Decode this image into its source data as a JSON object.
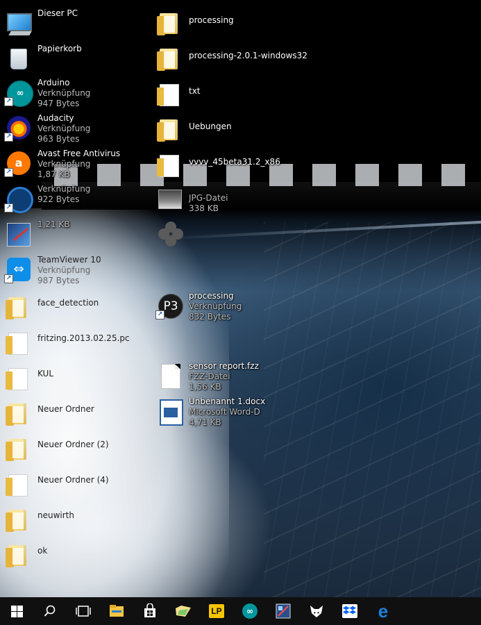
{
  "desktop_icons_left": [
    {
      "id": "dieser-pc",
      "name": "Dieser PC",
      "lines": []
    },
    {
      "id": "papierkorb",
      "name": "Papierkorb",
      "lines": []
    },
    {
      "id": "arduino",
      "name": "Arduino",
      "lines": [
        "Verknüpfung",
        "947 Bytes"
      ]
    },
    {
      "id": "audacity",
      "name": "Audacity",
      "lines": [
        "Verknüpfung",
        "963 Bytes"
      ]
    },
    {
      "id": "avast",
      "name": "Avast Free Antivirus",
      "lines": [
        "Verknüpfung",
        "1,87 KB"
      ]
    },
    {
      "id": "shortcut-blue",
      "name": "",
      "lines": [
        "Verknüpfung",
        "922 Bytes"
      ]
    },
    {
      "id": "shortcut-paint",
      "name": "",
      "lines": [
        "",
        "1,21 KB"
      ]
    },
    {
      "id": "teamviewer",
      "name": "TeamViewer 10",
      "lines": [
        "Verknüpfung",
        "987 Bytes"
      ]
    },
    {
      "id": "face-detection",
      "name": "face_detection",
      "lines": []
    },
    {
      "id": "fritzing",
      "name": "fritzing.2013.02.25.pc",
      "lines": []
    },
    {
      "id": "kul",
      "name": "KUL",
      "lines": []
    },
    {
      "id": "neuer-ordner",
      "name": "Neuer Ordner",
      "lines": []
    },
    {
      "id": "neuer-ordner-2",
      "name": "Neuer Ordner (2)",
      "lines": []
    },
    {
      "id": "neuer-ordner-4",
      "name": "Neuer Ordner (4)",
      "lines": []
    },
    {
      "id": "neuwirth",
      "name": "neuwirth",
      "lines": []
    },
    {
      "id": "ok",
      "name": "ok",
      "lines": []
    }
  ],
  "desktop_icons_right": [
    {
      "id": "processing-folder",
      "name": "processing",
      "lines": []
    },
    {
      "id": "processing-2-0-1",
      "name": "processing-2.0.1-windows32",
      "lines": []
    },
    {
      "id": "txt",
      "name": "txt",
      "lines": []
    },
    {
      "id": "uebungen",
      "name": "Uebungen",
      "lines": []
    },
    {
      "id": "vvvv",
      "name": "vvvv_45beta31.2_x86",
      "lines": []
    },
    {
      "id": "jpg-file",
      "name": "",
      "lines": [
        "JPG-Datei",
        "338 KB"
      ]
    },
    {
      "id": "clover-file",
      "name": "",
      "lines": []
    },
    {
      "id": "processing-shortcut",
      "name": "processing",
      "lines": [
        "Verknüpfung",
        "832 Bytes"
      ]
    },
    {
      "id": "sensor-report",
      "name": "sensor report.fzz",
      "lines": [
        "FZZ-Datei",
        "1,56 KB"
      ]
    },
    {
      "id": "unbenannt-docx",
      "name": "Unbenannt 1.docx",
      "lines": [
        "Microsoft Word-D",
        "4,71 KB"
      ]
    }
  ],
  "taskbar": {
    "items": [
      {
        "id": "start",
        "icon": "windows-logo-icon"
      },
      {
        "id": "search",
        "icon": "search-icon"
      },
      {
        "id": "task-view",
        "icon": "task-view-icon"
      },
      {
        "id": "file-explorer",
        "icon": "file-explorer-icon",
        "color": "#f4c542"
      },
      {
        "id": "store",
        "icon": "store-icon",
        "color": "#ffffff"
      },
      {
        "id": "folder-app",
        "icon": "folder-app-icon",
        "color": "#7cc86a"
      },
      {
        "id": "lp-app",
        "icon": "lp-icon",
        "color": "#f7c500",
        "label": "LP"
      },
      {
        "id": "arduino-app",
        "icon": "arduino-icon",
        "color": "#00979c"
      },
      {
        "id": "paint-app",
        "icon": "paint-icon",
        "color": "#4a7ec4"
      },
      {
        "id": "foobar-app",
        "icon": "fox-icon",
        "color": "#ffffff"
      },
      {
        "id": "dropbox-app",
        "icon": "dropbox-icon",
        "color": "#0061fe"
      },
      {
        "id": "edge-app",
        "icon": "edge-icon",
        "color": "#1e7fd6"
      }
    ]
  }
}
